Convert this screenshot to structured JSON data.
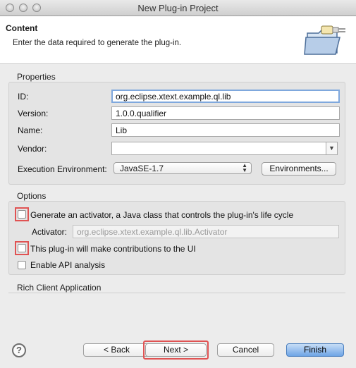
{
  "window": {
    "title": "New Plug-in Project"
  },
  "header": {
    "title": "Content",
    "subtitle": "Enter the data required to generate the plug-in."
  },
  "properties": {
    "group_label": "Properties",
    "id_label": "ID:",
    "id_value": "org.eclipse.xtext.example.ql.lib",
    "version_label": "Version:",
    "version_value": "1.0.0.qualifier",
    "name_label": "Name:",
    "name_value": "Lib",
    "vendor_label": "Vendor:",
    "vendor_value": "",
    "exec_env_label": "Execution Environment:",
    "exec_env_value": "JavaSE-1.7",
    "environments_button": "Environments..."
  },
  "options": {
    "group_label": "Options",
    "generate_activator": {
      "label": "Generate an activator, a Java class that controls the plug-in's life cycle",
      "checked": false
    },
    "activator_label": "Activator:",
    "activator_value": "org.eclipse.xtext.example.ql.lib.Activator",
    "ui_contributions": {
      "label": "This plug-in will make contributions to the UI",
      "checked": false
    },
    "api_analysis": {
      "label": "Enable API analysis",
      "checked": false
    }
  },
  "rich_client": {
    "group_label": "Rich Client Application"
  },
  "footer": {
    "help": "?",
    "back": "< Back",
    "next": "Next >",
    "cancel": "Cancel",
    "finish": "Finish"
  },
  "colors": {
    "accent": "#6fa5e6",
    "highlight": "#e05353",
    "focus": "#7fa8dd"
  },
  "icons": [
    "help-icon",
    "wizard-banner-icon",
    "dropdown-arrow-icon",
    "stepper-arrows-icon"
  ]
}
